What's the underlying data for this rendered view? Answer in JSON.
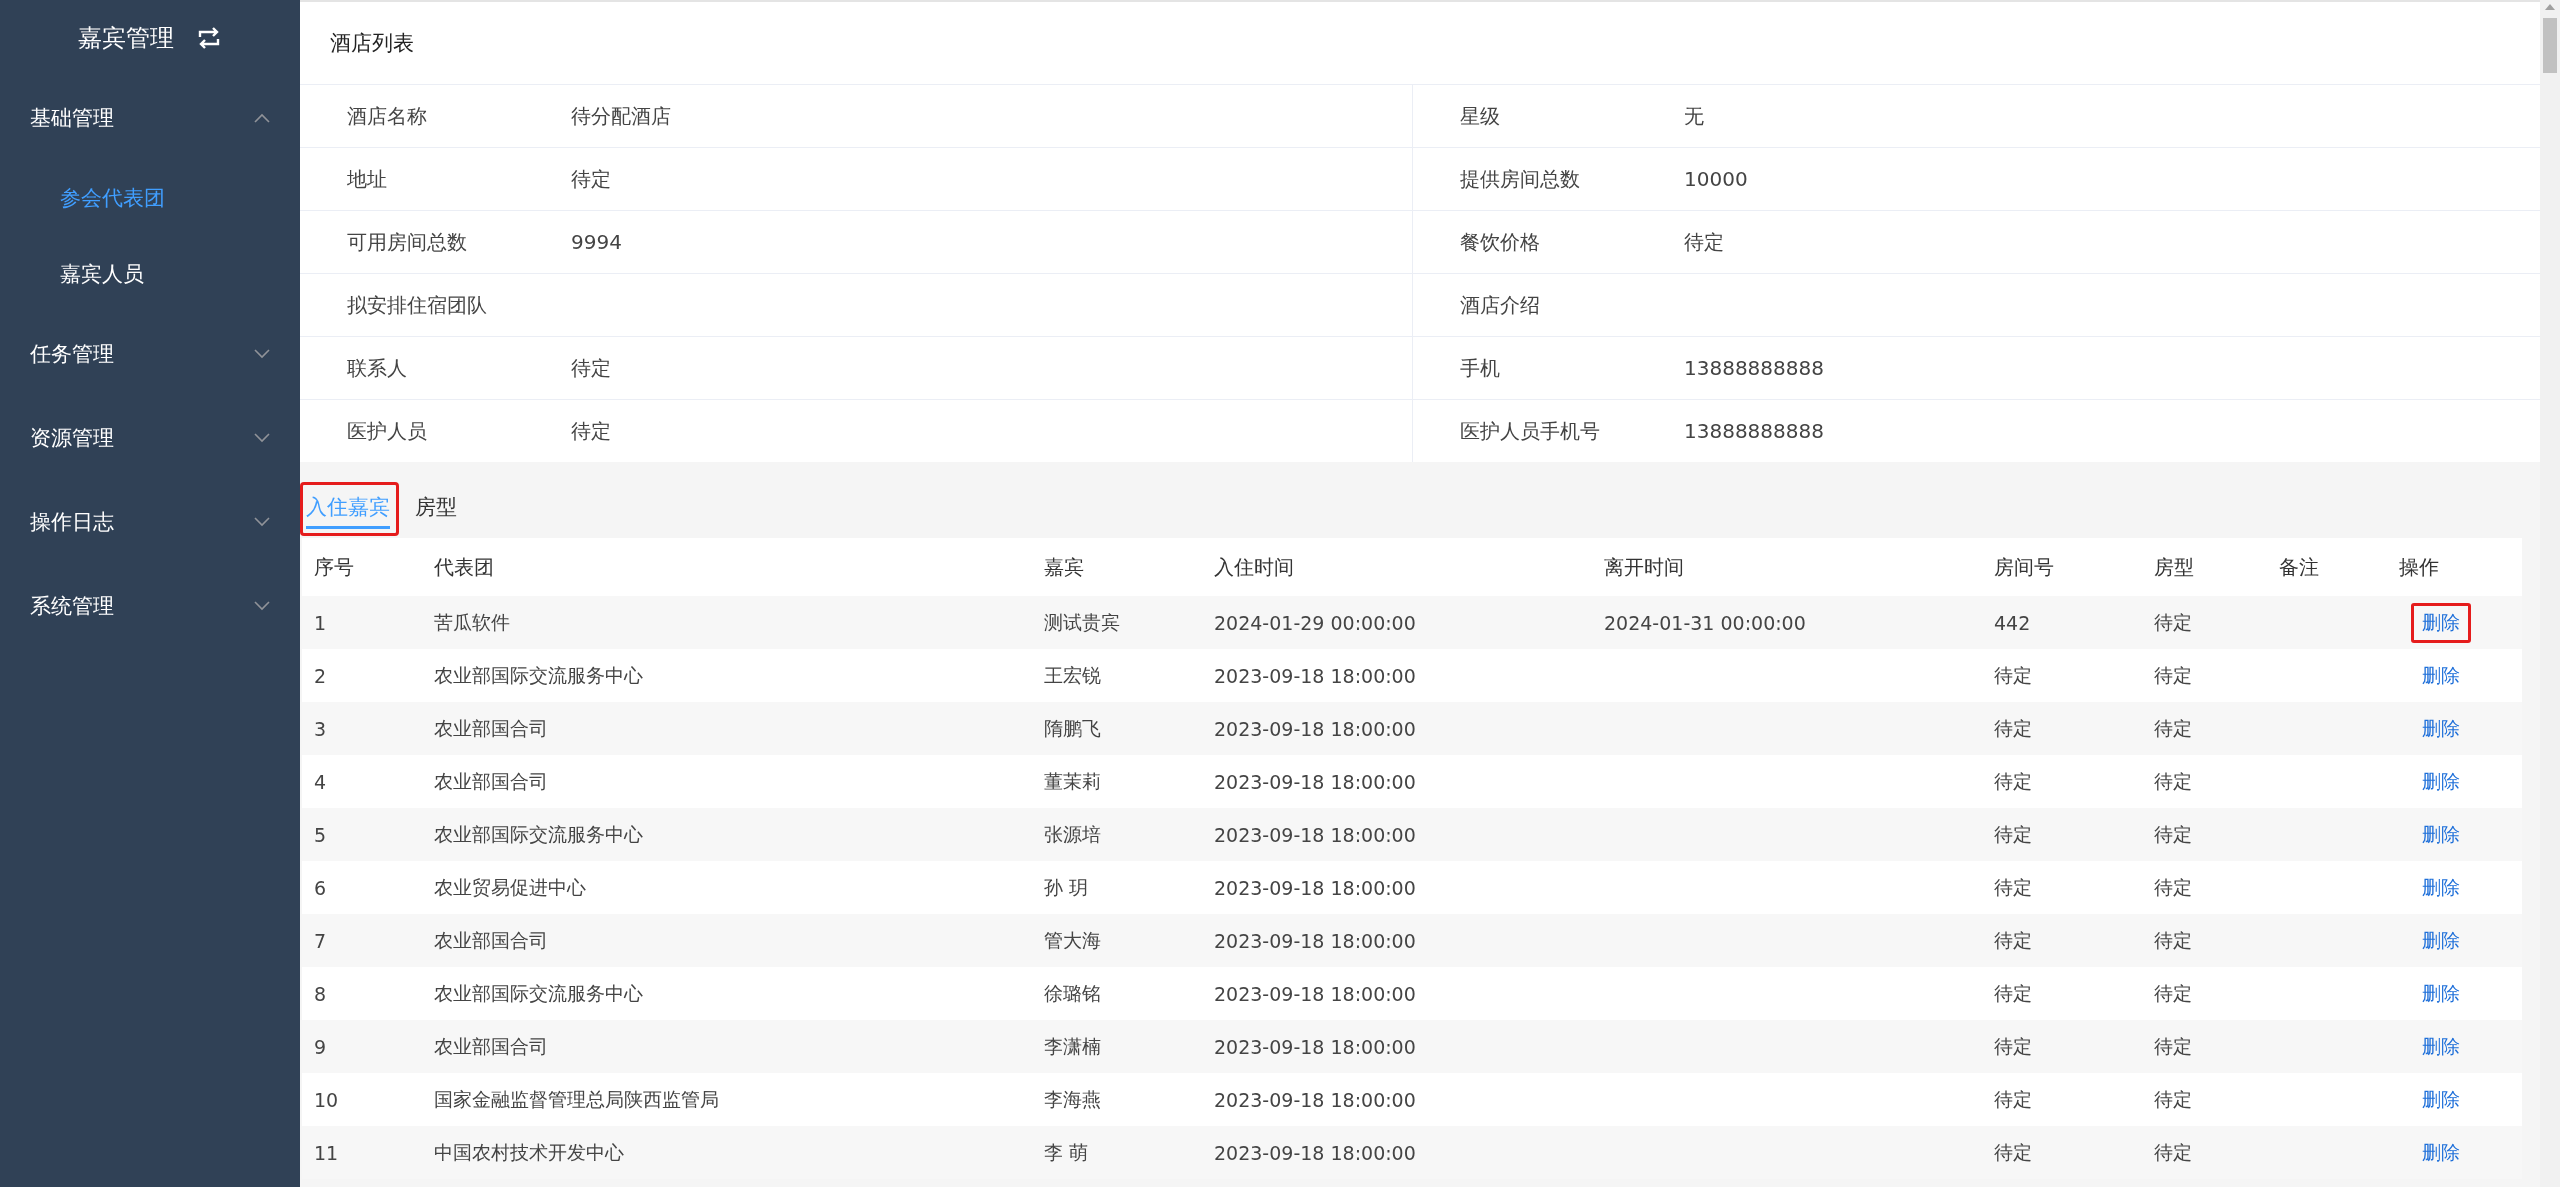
{
  "sidebar": {
    "title": "嘉宾管理",
    "items": [
      {
        "label": "基础管理",
        "expanded": true,
        "children": [
          {
            "label": "参会代表团",
            "selected": true
          },
          {
            "label": "嘉宾人员",
            "selected": false
          }
        ]
      },
      {
        "label": "任务管理",
        "expanded": false
      },
      {
        "label": "资源管理",
        "expanded": false
      },
      {
        "label": "操作日志",
        "expanded": false
      },
      {
        "label": "系统管理",
        "expanded": false
      }
    ]
  },
  "panel_title": "酒店列表",
  "details": [
    [
      {
        "label": "酒店名称",
        "value": "待分配酒店"
      },
      {
        "label": "星级",
        "value": "无"
      }
    ],
    [
      {
        "label": "地址",
        "value": "待定"
      },
      {
        "label": "提供房间总数",
        "value": "10000"
      }
    ],
    [
      {
        "label": "可用房间总数",
        "value": "9994"
      },
      {
        "label": "餐饮价格",
        "value": "待定"
      }
    ],
    [
      {
        "label": "拟安排住宿团队"
      },
      {
        "label": "酒店介绍"
      }
    ],
    [
      {
        "label": "联系人",
        "value": "待定"
      },
      {
        "label": "手机",
        "value": "13888888888"
      }
    ],
    [
      {
        "label": "医护人员",
        "value": "待定"
      },
      {
        "label": "医护人员手机号",
        "value": "13888888888"
      }
    ]
  ],
  "tabs": [
    {
      "label": "入住嘉宾",
      "selected": true,
      "highlighted": true
    },
    {
      "label": "房型",
      "selected": false,
      "highlighted": false
    }
  ],
  "table": {
    "columns": [
      "序号",
      "代表团",
      "嘉宾",
      "入住时间",
      "离开时间",
      "房间号",
      "房型",
      "备注",
      "操作"
    ],
    "rows": [
      {
        "cells": [
          "1",
          "苦瓜软件",
          "测试贵宾",
          "2024-01-29 00:00:00",
          "2024-01-31 00:00:00",
          "442",
          "待定",
          ""
        ],
        "action": "删除",
        "highlighted": true
      },
      {
        "cells": [
          "2",
          "农业部国际交流服务中心",
          "王宏锐",
          "2023-09-18 18:00:00",
          "",
          "待定",
          "待定",
          ""
        ],
        "action": "删除",
        "highlighted": false
      },
      {
        "cells": [
          "3",
          "农业部国合司",
          "隋鹏飞",
          "2023-09-18 18:00:00",
          "",
          "待定",
          "待定",
          ""
        ],
        "action": "删除",
        "highlighted": false
      },
      {
        "cells": [
          "4",
          "农业部国合司",
          "董茉莉",
          "2023-09-18 18:00:00",
          "",
          "待定",
          "待定",
          ""
        ],
        "action": "删除",
        "highlighted": false
      },
      {
        "cells": [
          "5",
          "农业部国际交流服务中心",
          "张源培",
          "2023-09-18 18:00:00",
          "",
          "待定",
          "待定",
          ""
        ],
        "action": "删除",
        "highlighted": false
      },
      {
        "cells": [
          "6",
          "农业贸易促进中心",
          "孙 玥",
          "2023-09-18 18:00:00",
          "",
          "待定",
          "待定",
          ""
        ],
        "action": "删除",
        "highlighted": false
      },
      {
        "cells": [
          "7",
          "农业部国合司",
          "管大海",
          "2023-09-18 18:00:00",
          "",
          "待定",
          "待定",
          ""
        ],
        "action": "删除",
        "highlighted": false
      },
      {
        "cells": [
          "8",
          "农业部国际交流服务中心",
          "徐璐铭",
          "2023-09-18 18:00:00",
          "",
          "待定",
          "待定",
          ""
        ],
        "action": "删除",
        "highlighted": false
      },
      {
        "cells": [
          "9",
          "农业部国合司",
          "李潇楠",
          "2023-09-18 18:00:00",
          "",
          "待定",
          "待定",
          ""
        ],
        "action": "删除",
        "highlighted": false
      },
      {
        "cells": [
          "10",
          "国家金融监督管理总局陕西监管局",
          "李海燕",
          "2023-09-18 18:00:00",
          "",
          "待定",
          "待定",
          ""
        ],
        "action": "删除",
        "highlighted": false
      },
      {
        "cells": [
          "11",
          "中国农村技术开发中心",
          "李 萌",
          "2023-09-18 18:00:00",
          "",
          "待定",
          "待定",
          ""
        ],
        "action": "删除",
        "highlighted": false
      }
    ]
  }
}
